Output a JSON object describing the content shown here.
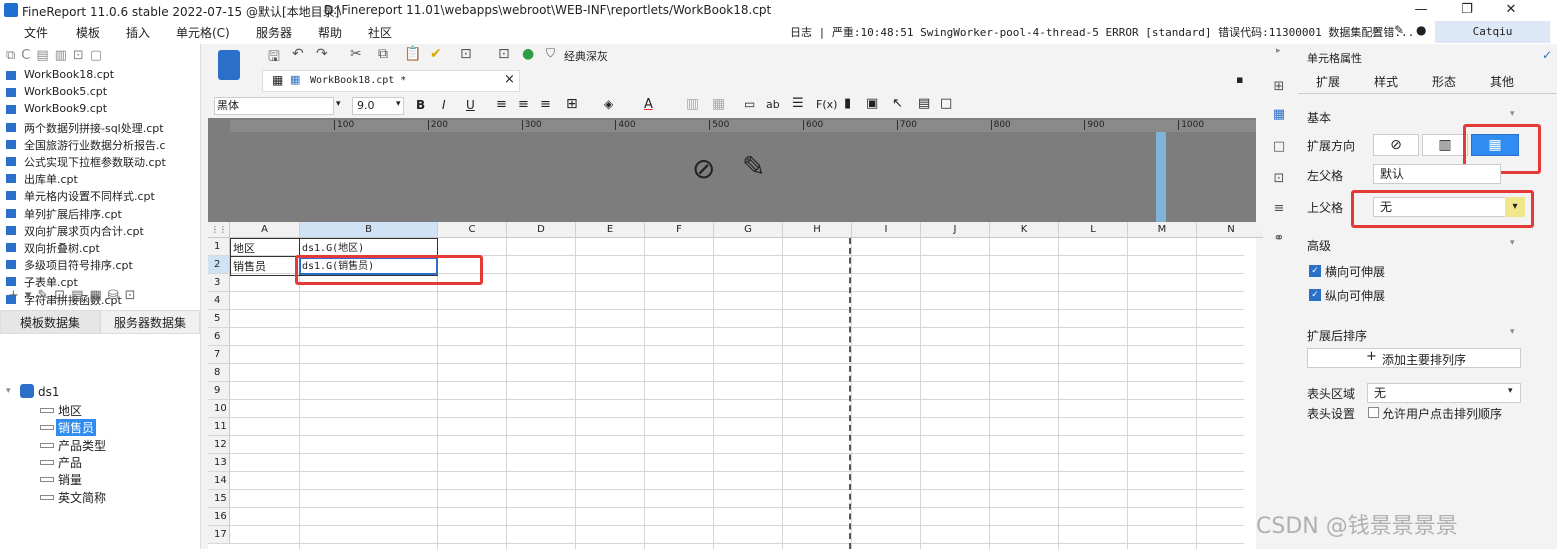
{
  "window": {
    "title": "FineReport 11.0.6 stable 2022-07-15 @默认[本地目录]",
    "path": "D:\\Finereport 11.01\\webapps\\webroot\\WEB-INF\\reportlets/WorkBook18.cpt",
    "minimize": "—",
    "restore": "❐",
    "close": "✕"
  },
  "menu": [
    "文件",
    "模板",
    "插入",
    "单元格(C)",
    "服务器",
    "帮助",
    "社区"
  ],
  "log": "日志 | 严重:10:48:51 SwingWorker-pool-4-thread-5 ERROR [standard] 错误代码:11300001 数据集配置错...",
  "user": "Catqiu",
  "files": [
    "WorkBook18.cpt",
    "WorkBook5.cpt",
    "WorkBook9.cpt",
    "两个数据列拼接-sql处理.cpt",
    "全国旅游行业数据分析报告.c",
    "公式实现下拉框参数联动.cpt",
    "出库单.cpt",
    "单元格内设置不同样式.cpt",
    "单列扩展后排序.cpt",
    "双向扩展求页内合计.cpt",
    "双向折叠树.cpt",
    "多级项目符号排序.cpt",
    "子表单.cpt",
    "字符串拼接函数.cpt",
    "折叠树"
  ],
  "dataset_tabs": [
    "模板数据集",
    "服务器数据集"
  ],
  "dataset": {
    "name": "ds1",
    "fields": [
      "地区",
      "销售员",
      "产品类型",
      "产品",
      "销量",
      "英文简称"
    ]
  },
  "tab": {
    "label": "WorkBook18.cpt *",
    "close": "×"
  },
  "toolbar": {
    "style_label": "经典深灰",
    "font": "黑体",
    "size": "9.0"
  },
  "ruler": [
    "100",
    "200",
    "300",
    "400",
    "500",
    "600",
    "700",
    "800",
    "900",
    "1000"
  ],
  "columns": [
    "A",
    "B",
    "C",
    "D",
    "E",
    "F",
    "G",
    "H",
    "I",
    "J",
    "K",
    "L",
    "M",
    "N"
  ],
  "rows": [
    "1",
    "2",
    "3",
    "4",
    "5",
    "6",
    "7",
    "8",
    "9",
    "10",
    "11",
    "12",
    "13",
    "14",
    "15",
    "16",
    "17"
  ],
  "cells": {
    "a1": "地区",
    "b1": "ds1.G(地区)",
    "a2": "销售员",
    "b2": "ds1.G(销售员)"
  },
  "props": {
    "title": "单元格属性",
    "tabs": [
      "扩展",
      "样式",
      "形态",
      "其他"
    ],
    "basic": "基本",
    "expand_dir": "扩展方向",
    "left_parent": "左父格",
    "left_parent_value": "默认",
    "top_parent": "上父格",
    "top_parent_value": "无",
    "advanced": "高级",
    "h_expand": "横向可伸展",
    "v_expand": "纵向可伸展",
    "sort_section": "扩展后排序",
    "add_sort": "添加主要排列序",
    "header_area": "表头区域",
    "header_area_value": "无",
    "header_setting": "表头设置",
    "allow_sort": "允许用户点击排列顺序"
  },
  "watermark": "CSDN @钱景景景景",
  "colors": {
    "accent": "#2a6fc9",
    "highlight": "#e53935",
    "ruler": "#7d7d7d"
  }
}
